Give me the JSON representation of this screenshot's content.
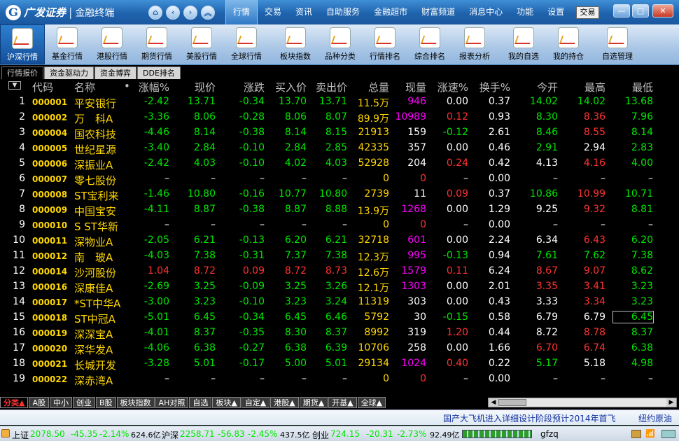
{
  "window": {
    "brand": "广发证券",
    "product": "金融终端",
    "trade_button": "交易",
    "menu": [
      "行情",
      "交易",
      "资讯",
      "自助服务",
      "金融超市",
      "财富频道",
      "消息中心",
      "功能",
      "设置"
    ],
    "active_menu": "行情"
  },
  "toolbar": [
    "沪深行情",
    "基金行情",
    "港股行情",
    "期货行情",
    "美股行情",
    "全球行情",
    "板块指数",
    "品种分类",
    "行情排名",
    "综合排名",
    "报表分析",
    "我的自选",
    "我的持仓",
    "自选管理"
  ],
  "tabs": [
    "行情报价",
    "资金驱动力",
    "资金博弈",
    "DDE排名"
  ],
  "columns": [
    "代码",
    "名称",
    "•",
    "涨幅%",
    "现价",
    "涨跌",
    "买入价",
    "卖出价",
    "总量",
    "现量",
    "涨速%",
    "换手%",
    "今开",
    "最高",
    "最低"
  ],
  "colors": {
    "up": "#ff3232",
    "down": "#00e600",
    "flat": "#ffffff",
    "volume": "#ffd700",
    "current_volume": "#ff00ff"
  },
  "rows": [
    {
      "idx": "1",
      "code": "000001",
      "name": "平安银行",
      "chg_pct": "-2.42",
      "price": "13.71",
      "chg": "-0.34",
      "bid": "13.70",
      "ask": "13.71",
      "vol": "11.5万",
      "cur_vol": "946",
      "speed": "0.00",
      "turnover": "0.37",
      "open": "14.02",
      "high": "14.02",
      "low": "13.68"
    },
    {
      "idx": "2",
      "code": "000002",
      "name": "万　科A",
      "chg_pct": "-3.36",
      "price": "8.06",
      "chg": "-0.28",
      "bid": "8.06",
      "ask": "8.07",
      "vol": "89.9万",
      "cur_vol": "10989",
      "speed": "0.12",
      "turnover": "0.93",
      "open": "8.30",
      "high": "8.36",
      "low": "7.96"
    },
    {
      "idx": "3",
      "code": "000004",
      "name": "国农科技",
      "chg_pct": "-4.46",
      "price": "8.14",
      "chg": "-0.38",
      "bid": "8.14",
      "ask": "8.15",
      "vol": "21913",
      "cur_vol": "159",
      "speed": "-0.12",
      "turnover": "2.61",
      "open": "8.46",
      "high": "8.55",
      "low": "8.14"
    },
    {
      "idx": "4",
      "code": "000005",
      "name": "世纪星源",
      "chg_pct": "-3.40",
      "price": "2.84",
      "chg": "-0.10",
      "bid": "2.84",
      "ask": "2.85",
      "vol": "42335",
      "cur_vol": "357",
      "speed": "0.00",
      "turnover": "0.46",
      "open": "2.91",
      "high": "2.94",
      "low": "2.83"
    },
    {
      "idx": "5",
      "code": "000006",
      "name": "深振业A",
      "chg_pct": "-2.42",
      "price": "4.03",
      "chg": "-0.10",
      "bid": "4.02",
      "ask": "4.03",
      "vol": "52928",
      "cur_vol": "204",
      "speed": "0.24",
      "turnover": "0.42",
      "open": "4.13",
      "high": "4.16",
      "low": "4.00"
    },
    {
      "idx": "6",
      "code": "000007",
      "name": "零七股份",
      "chg_pct": "–",
      "price": "–",
      "chg": "–",
      "bid": "–",
      "ask": "–",
      "vol": "0",
      "cur_vol": "0",
      "speed": "–",
      "turnover": "0.00",
      "open": "–",
      "high": "–",
      "low": "–"
    },
    {
      "idx": "7",
      "code": "000008",
      "name": "ST宝利来",
      "chg_pct": "-1.46",
      "price": "10.80",
      "chg": "-0.16",
      "bid": "10.77",
      "ask": "10.80",
      "vol": "2739",
      "cur_vol": "11",
      "speed": "0.09",
      "turnover": "0.37",
      "open": "10.86",
      "high": "10.99",
      "low": "10.71"
    },
    {
      "idx": "8",
      "code": "000009",
      "name": "中国宝安",
      "chg_pct": "-4.11",
      "price": "8.87",
      "chg": "-0.38",
      "bid": "8.87",
      "ask": "8.88",
      "vol": "13.9万",
      "cur_vol": "1268",
      "speed": "0.00",
      "turnover": "1.29",
      "open": "9.25",
      "high": "9.32",
      "low": "8.81"
    },
    {
      "idx": "9",
      "code": "000010",
      "name": "S ST华新",
      "chg_pct": "–",
      "price": "–",
      "chg": "–",
      "bid": "–",
      "ask": "–",
      "vol": "0",
      "cur_vol": "0",
      "speed": "–",
      "turnover": "0.00",
      "open": "–",
      "high": "–",
      "low": "–"
    },
    {
      "idx": "10",
      "code": "000011",
      "name": "深物业A",
      "chg_pct": "-2.05",
      "price": "6.21",
      "chg": "-0.13",
      "bid": "6.20",
      "ask": "6.21",
      "vol": "32718",
      "cur_vol": "601",
      "speed": "0.00",
      "turnover": "2.24",
      "open": "6.34",
      "high": "6.43",
      "low": "6.20"
    },
    {
      "idx": "11",
      "code": "000012",
      "name": "南　玻A",
      "chg_pct": "-4.03",
      "price": "7.38",
      "chg": "-0.31",
      "bid": "7.37",
      "ask": "7.38",
      "vol": "12.3万",
      "cur_vol": "995",
      "speed": "-0.13",
      "turnover": "0.94",
      "open": "7.61",
      "high": "7.62",
      "low": "7.38"
    },
    {
      "idx": "12",
      "code": "000014",
      "name": "沙河股份",
      "chg_pct": "1.04",
      "price": "8.72",
      "chg": "0.09",
      "bid": "8.72",
      "ask": "8.73",
      "vol": "12.6万",
      "cur_vol": "1579",
      "speed": "0.11",
      "turnover": "6.24",
      "open": "8.67",
      "high": "9.07",
      "low": "8.62"
    },
    {
      "idx": "13",
      "code": "000016",
      "name": "深康佳A",
      "chg_pct": "-2.69",
      "price": "3.25",
      "chg": "-0.09",
      "bid": "3.25",
      "ask": "3.26",
      "vol": "12.1万",
      "cur_vol": "1303",
      "speed": "0.00",
      "turnover": "2.01",
      "open": "3.35",
      "high": "3.41",
      "low": "3.23"
    },
    {
      "idx": "14",
      "code": "000017",
      "name": "*ST中华A",
      "chg_pct": "-3.00",
      "price": "3.23",
      "chg": "-0.10",
      "bid": "3.23",
      "ask": "3.24",
      "vol": "11319",
      "cur_vol": "303",
      "speed": "0.00",
      "turnover": "0.43",
      "open": "3.33",
      "high": "3.34",
      "low": "3.23"
    },
    {
      "idx": "15",
      "code": "000018",
      "name": "ST中冠A",
      "chg_pct": "-5.01",
      "price": "6.45",
      "chg": "-0.34",
      "bid": "6.45",
      "ask": "6.46",
      "vol": "5792",
      "cur_vol": "30",
      "speed": "-0.15",
      "turnover": "0.58",
      "open": "6.79",
      "high": "6.79",
      "low": "6.45"
    },
    {
      "idx": "16",
      "code": "000019",
      "name": "深深宝A",
      "chg_pct": "-4.01",
      "price": "8.37",
      "chg": "-0.35",
      "bid": "8.30",
      "ask": "8.37",
      "vol": "8992",
      "cur_vol": "319",
      "speed": "1.20",
      "turnover": "0.44",
      "open": "8.72",
      "high": "8.78",
      "low": "8.37"
    },
    {
      "idx": "17",
      "code": "000020",
      "name": "深华发A",
      "chg_pct": "-4.06",
      "price": "6.38",
      "chg": "-0.27",
      "bid": "6.38",
      "ask": "6.39",
      "vol": "10706",
      "cur_vol": "258",
      "speed": "0.00",
      "turnover": "1.66",
      "open": "6.70",
      "high": "6.74",
      "low": "6.38"
    },
    {
      "idx": "18",
      "code": "000021",
      "name": "长城开发",
      "chg_pct": "-3.28",
      "price": "5.01",
      "chg": "-0.17",
      "bid": "5.00",
      "ask": "5.01",
      "vol": "29134",
      "cur_vol": "1024",
      "speed": "0.40",
      "turnover": "0.22",
      "open": "5.17",
      "high": "5.18",
      "low": "4.98"
    },
    {
      "idx": "19",
      "code": "000022",
      "name": "深赤湾A",
      "chg_pct": "–",
      "price": "–",
      "chg": "–",
      "bid": "–",
      "ask": "–",
      "vol": "0",
      "cur_vol": "0",
      "speed": "–",
      "turnover": "0.00",
      "open": "–",
      "high": "–",
      "low": "–"
    }
  ],
  "sheets": [
    "分类▲",
    "A股",
    "中小",
    "创业",
    "B股",
    "板块指数",
    "AH对照",
    "自选",
    "板块▲",
    "自定▲",
    "港股▲",
    "期货▲",
    "开基▲",
    "全球▲"
  ],
  "ticker": {
    "news1": "国产大飞机进入详细设计阶段预计2014年首飞",
    "news2": "纽约原油"
  },
  "status": {
    "sh_label": "上证",
    "sh_value": "2078.50",
    "sh_chg": "-45.35",
    "sh_pct": "-2.14%",
    "sh_amount": "624.6亿",
    "sz_label": "沪深",
    "sz_value": "2258.71",
    "sz_chg": "-56.83",
    "sz_pct": "-2.45%",
    "sz_amount": "437.5亿",
    "cy_label": "创业",
    "cy_value": "724.15",
    "cy_chg": "-20.31",
    "cy_pct": "-2.73%",
    "cy_amount": "92.49亿",
    "user": "gfzq"
  }
}
